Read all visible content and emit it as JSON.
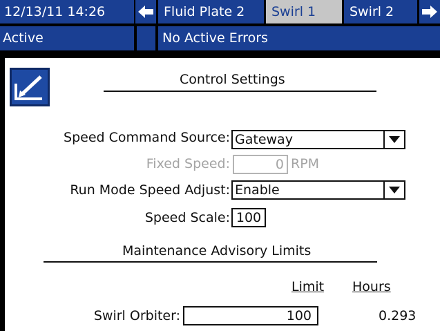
{
  "header": {
    "datetime": "12/13/11 14:26",
    "tabs": [
      {
        "label": "Fluid Plate 2",
        "active": false
      },
      {
        "label": "Swirl 1",
        "active": true
      },
      {
        "label": "Swirl 2",
        "active": false
      }
    ],
    "prev_icon": "left-arrow-icon",
    "next_icon": "right-arrow-icon"
  },
  "status": {
    "mode": "Active",
    "errors": "No Active Errors"
  },
  "edit_icon": "edit-screen-icon",
  "control_settings": {
    "title": "Control Settings",
    "speed_command_source": {
      "label": "Speed Command Source:",
      "value": "Gateway"
    },
    "fixed_speed": {
      "label": "Fixed Speed:",
      "value": "0",
      "unit": "RPM",
      "disabled": true
    },
    "run_mode_speed_adjust": {
      "label": "Run Mode Speed Adjust:",
      "value": "Enable"
    },
    "speed_scale": {
      "label": "Speed Scale:",
      "value": "100"
    }
  },
  "maintenance": {
    "title": "Maintenance Advisory Limits",
    "col_limit": "Limit",
    "col_hours": "Hours",
    "rows": [
      {
        "label": "Swirl Orbiter:",
        "limit": "100",
        "hours": "0.293"
      }
    ]
  },
  "colors": {
    "bar": "#1a3f93",
    "active_tab": "#c6c6c6",
    "disabled_text": "#a4a4a4"
  }
}
